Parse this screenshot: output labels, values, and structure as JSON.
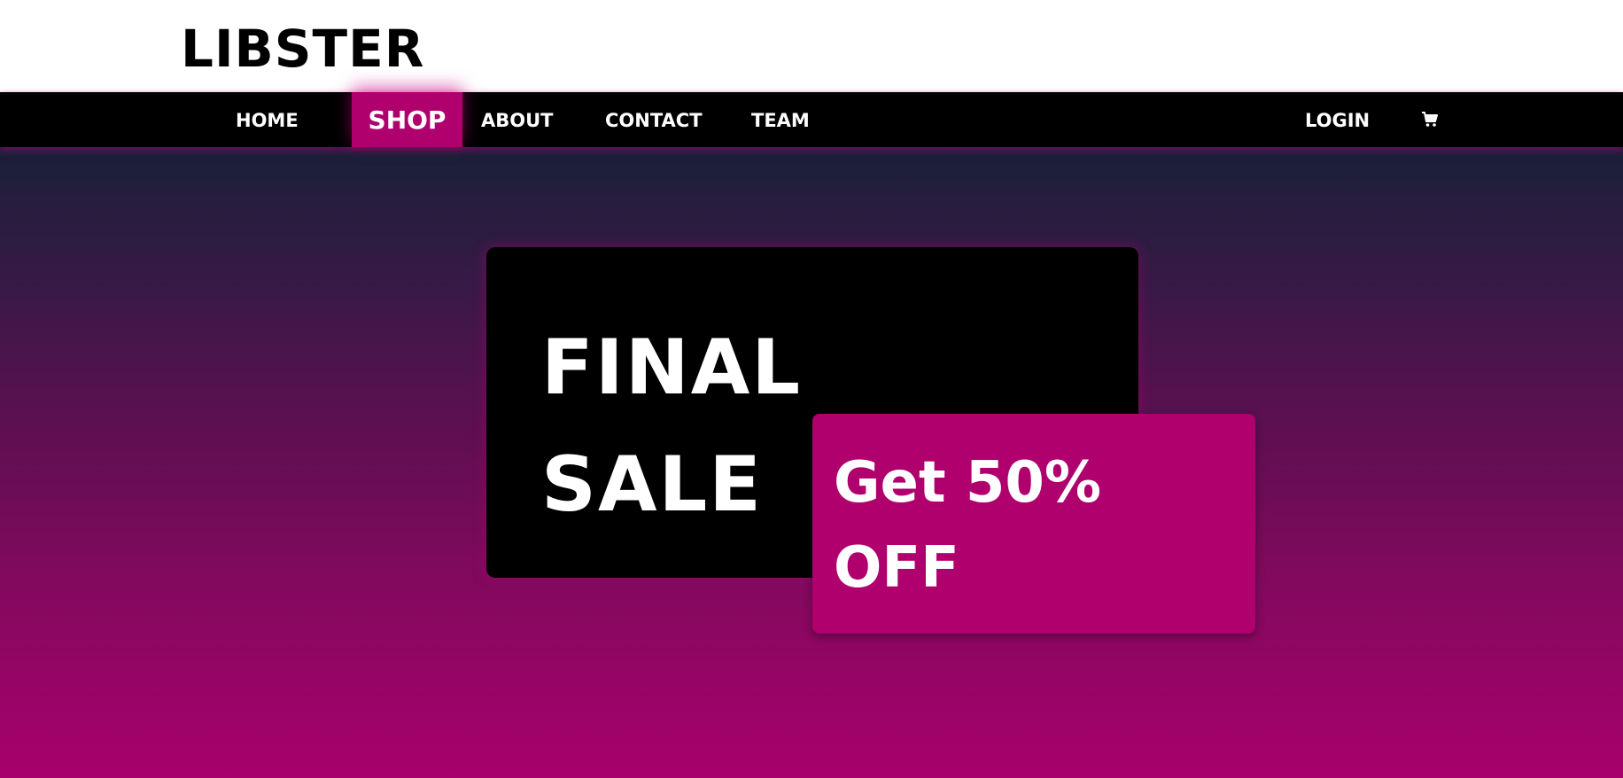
{
  "brand": {
    "logo_text": "LIBSTER"
  },
  "nav": {
    "home": "HOME",
    "shop": "SHOP",
    "about": "ABOUT",
    "contact": "CONTACT",
    "team": "TEAM",
    "login": "LOGIN",
    "cart_icon": "cart-icon",
    "active_item": "SHOP"
  },
  "hero": {
    "sale_line1": "FINAL",
    "sale_line2": "SALE",
    "offer_line1": "Get 50%",
    "offer_line2": "OFF"
  },
  "colors": {
    "accent": "#b0006e",
    "nav_bg": "#000000",
    "gradient_top": "#1a2038",
    "gradient_bottom": "#a8006c"
  }
}
